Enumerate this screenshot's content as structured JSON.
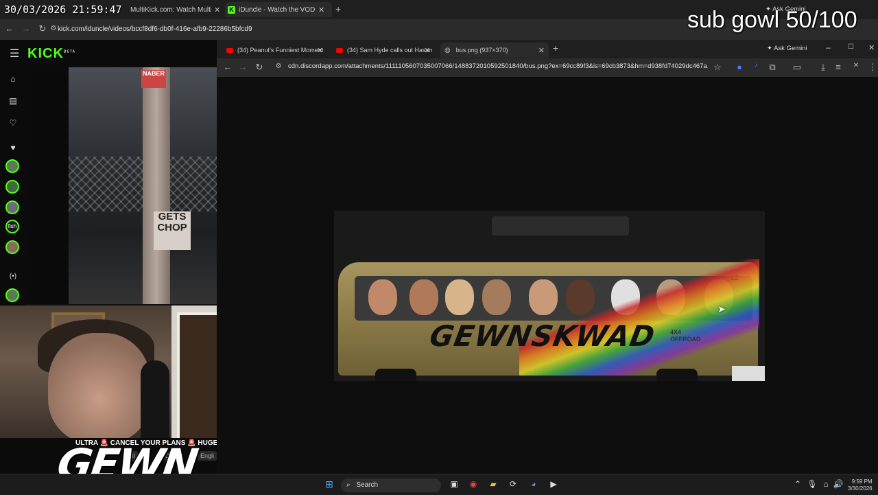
{
  "overlay": {
    "timestamp": "30/03/2026 21:59:47",
    "sub_goal": "sub gowl 50/100"
  },
  "outer_browser": {
    "tabs": [
      {
        "label": "MultiKick.com: Watch Multiple",
        "active": false
      },
      {
        "label": "iDuncle - Watch the VOD on K",
        "active": true
      }
    ],
    "url": "kick.com/iduncle/videos/bccf8df6-db0f-416e-afb9-22286b5bfcd9",
    "ask_gemini": "Ask Gemini"
  },
  "kick": {
    "logo": "KICK",
    "logo_badge": "BETA",
    "sidebar_icons": [
      "home-icon",
      "browse-icon",
      "following-icon",
      "heart-icon"
    ],
    "sidebar_avatar_label": "fish",
    "sign_top": "NABER",
    "sign_main": "GETS CHOP",
    "ticker": "ULTRA 🚨 CANCEL YOUR PLANS 🚨 HUGE CON",
    "ticker_chips": [
      "Il",
      "C",
      "Engli"
    ],
    "streamer_logo": "GEWN"
  },
  "inner_browser": {
    "tabs": [
      {
        "label": "(34) Peanut's Funniest Moment",
        "icon": "youtube-icon"
      },
      {
        "label": "(34) Sam Hyde calls out Hasan",
        "icon": "youtube-icon"
      },
      {
        "label": "bus.png (937×370)",
        "icon": "image-icon",
        "active": true
      }
    ],
    "url": "cdn.discordapp.com/attachments/1111105607035007066/1488372010592501840/bus.png?ex=69cc89f3&is=69cb3873&hm=d938fd74029dc467a...",
    "ask_gemini": "Ask Gemini"
  },
  "image": {
    "bus_text": "GEWNSKWAD",
    "side_text": "4X4 OFFROAD",
    "number": "12"
  },
  "taskbar": {
    "search_label": "Search",
    "time": "9:59 PM",
    "date": "3/30/2026"
  },
  "colors": {
    "kick_green": "#53fc18",
    "youtube_red": "#ff0000"
  }
}
